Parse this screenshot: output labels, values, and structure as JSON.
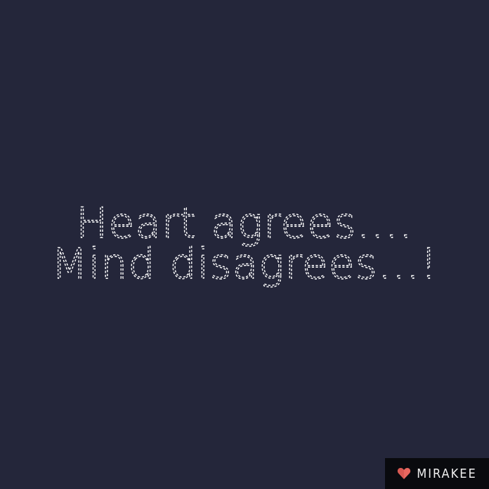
{
  "quote": {
    "line1": "Heart agrees....",
    "line2": "Mind disagrees...!"
  },
  "brand": {
    "name": "MIRAKEE",
    "icon": "heart-icon",
    "icon_color": "#e8675f"
  },
  "colors": {
    "background": "#24263a",
    "text": "#ffffff",
    "badge_background": "#090a0e"
  }
}
